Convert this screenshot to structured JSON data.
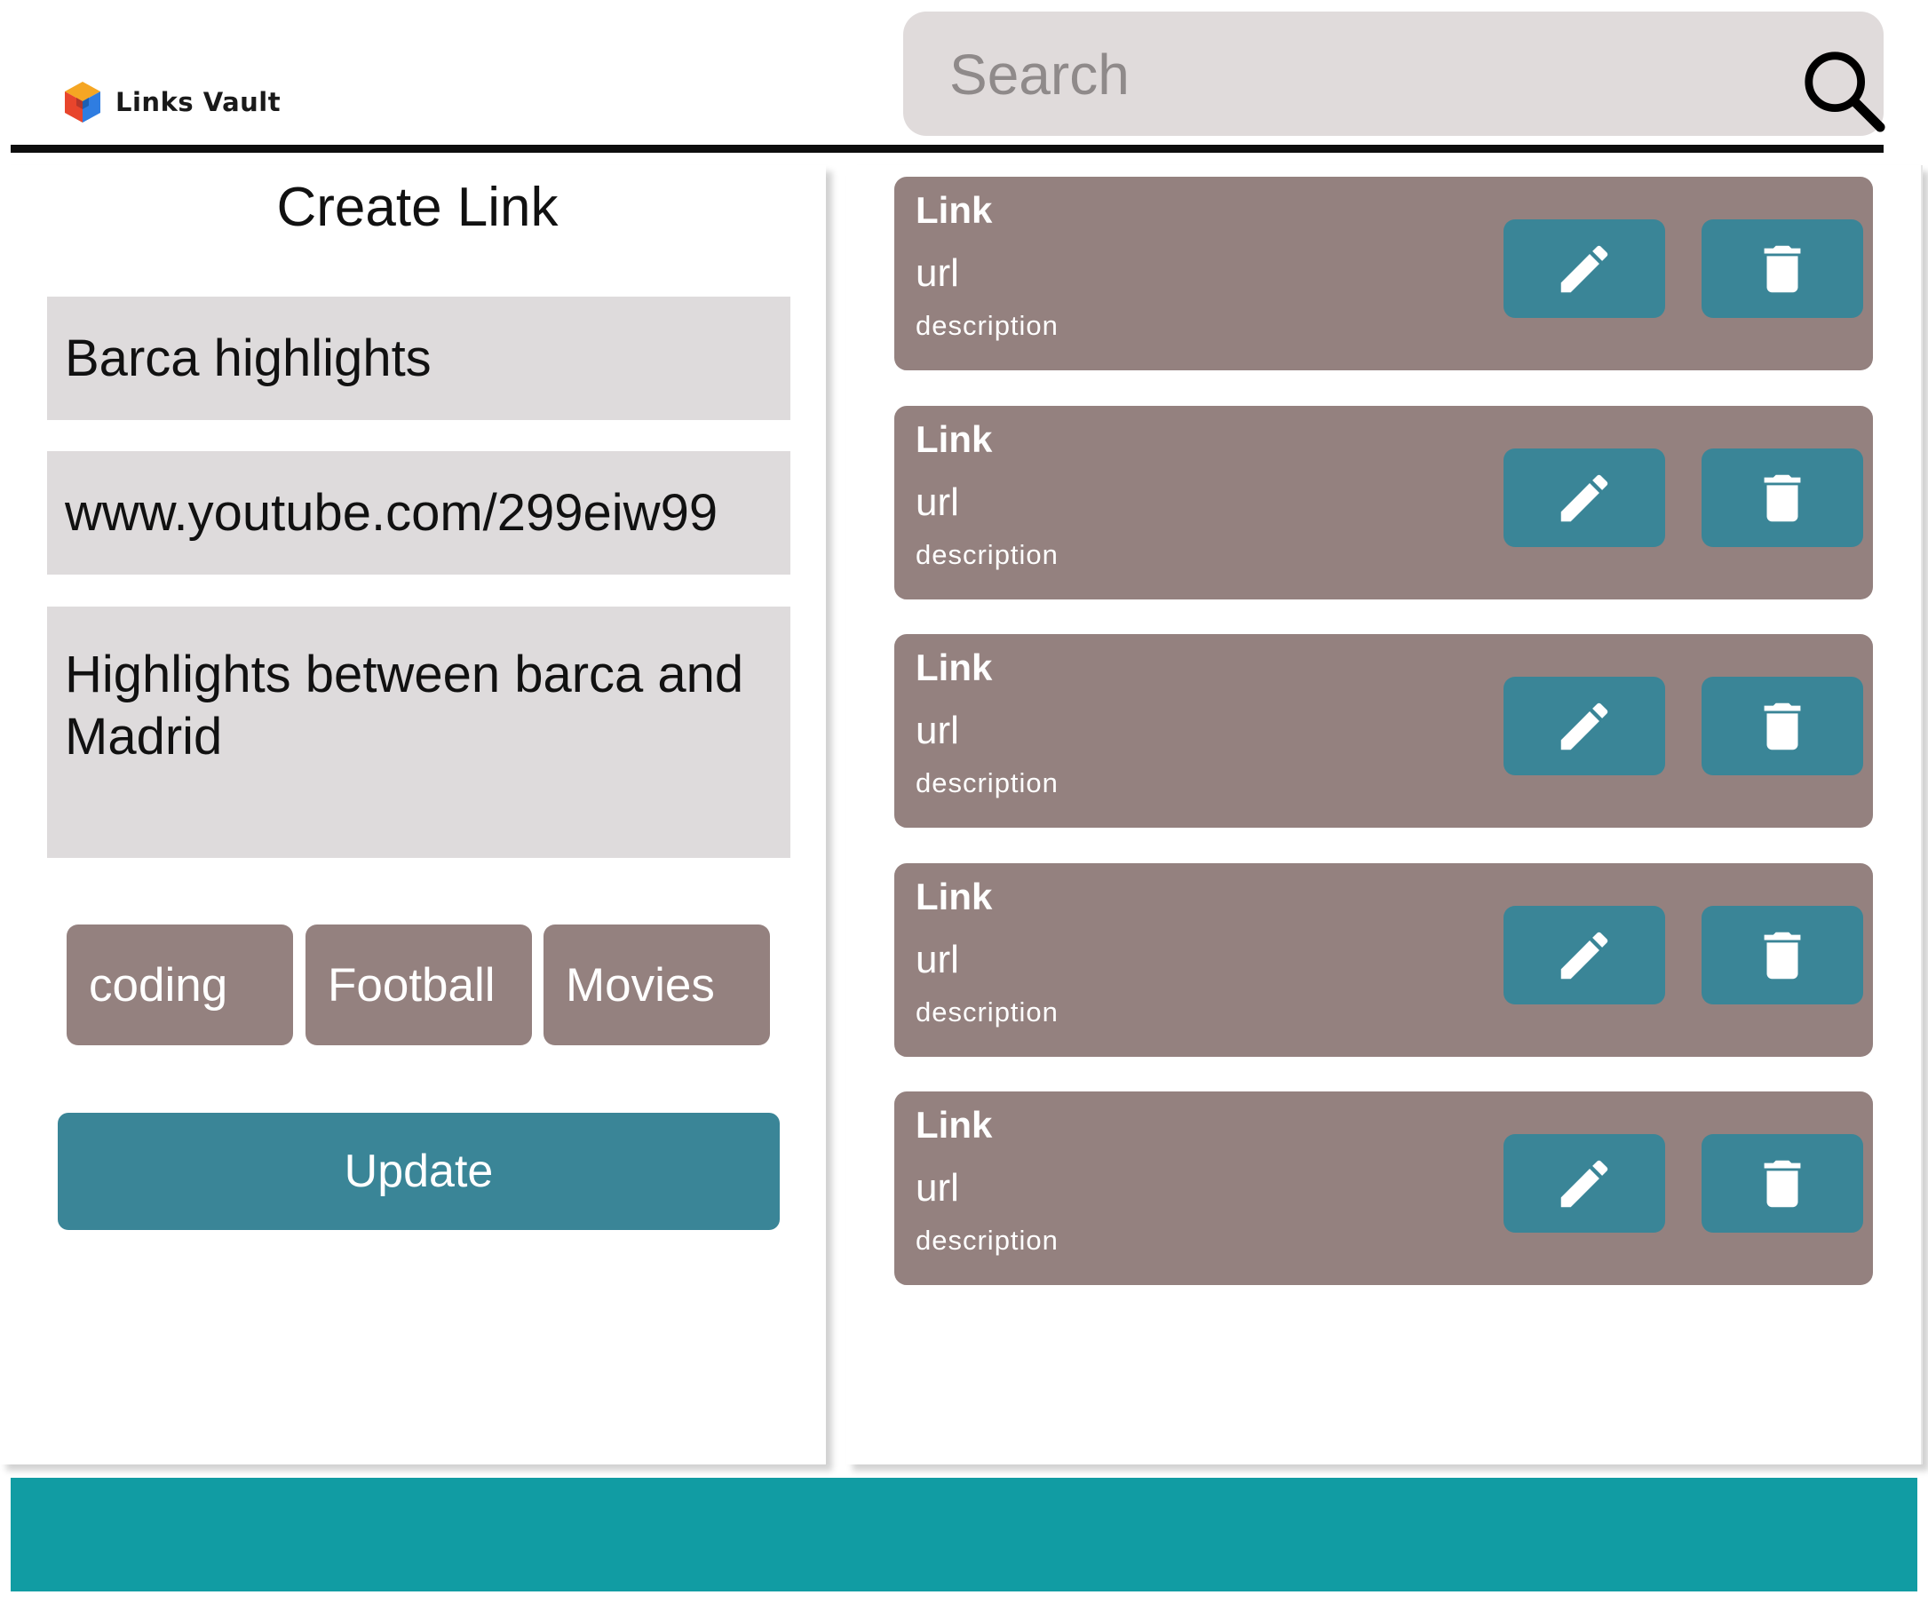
{
  "app": {
    "logo_text": "Links Vault",
    "colors": {
      "accent": "#3a8597",
      "card": "#94817f",
      "field": "#dedbdc",
      "search": "#e0dbdb",
      "footer": "#119ca3"
    }
  },
  "header": {
    "search": {
      "placeholder": "Search",
      "value": ""
    }
  },
  "form": {
    "title": "Create Link",
    "name_value": "Barca highlights",
    "url_value": "www.youtube.com/299eiw99",
    "description_value": "Highlights between barca and Madrid",
    "tags": [
      "coding",
      "Football",
      "Movies"
    ],
    "submit_label": "Update"
  },
  "links": [
    {
      "title": "Link",
      "url": "url",
      "description": "description",
      "edit_icon": "pencil-icon",
      "delete_icon": "trash-icon"
    },
    {
      "title": "Link",
      "url": "url",
      "description": "description",
      "edit_icon": "pencil-icon",
      "delete_icon": "trash-icon"
    },
    {
      "title": "Link",
      "url": "url",
      "description": "description",
      "edit_icon": "pencil-icon",
      "delete_icon": "trash-icon"
    },
    {
      "title": "Link",
      "url": "url",
      "description": "description",
      "edit_icon": "pencil-icon",
      "delete_icon": "trash-icon"
    },
    {
      "title": "Link",
      "url": "url",
      "description": "description",
      "edit_icon": "pencil-icon",
      "delete_icon": "trash-icon"
    }
  ]
}
